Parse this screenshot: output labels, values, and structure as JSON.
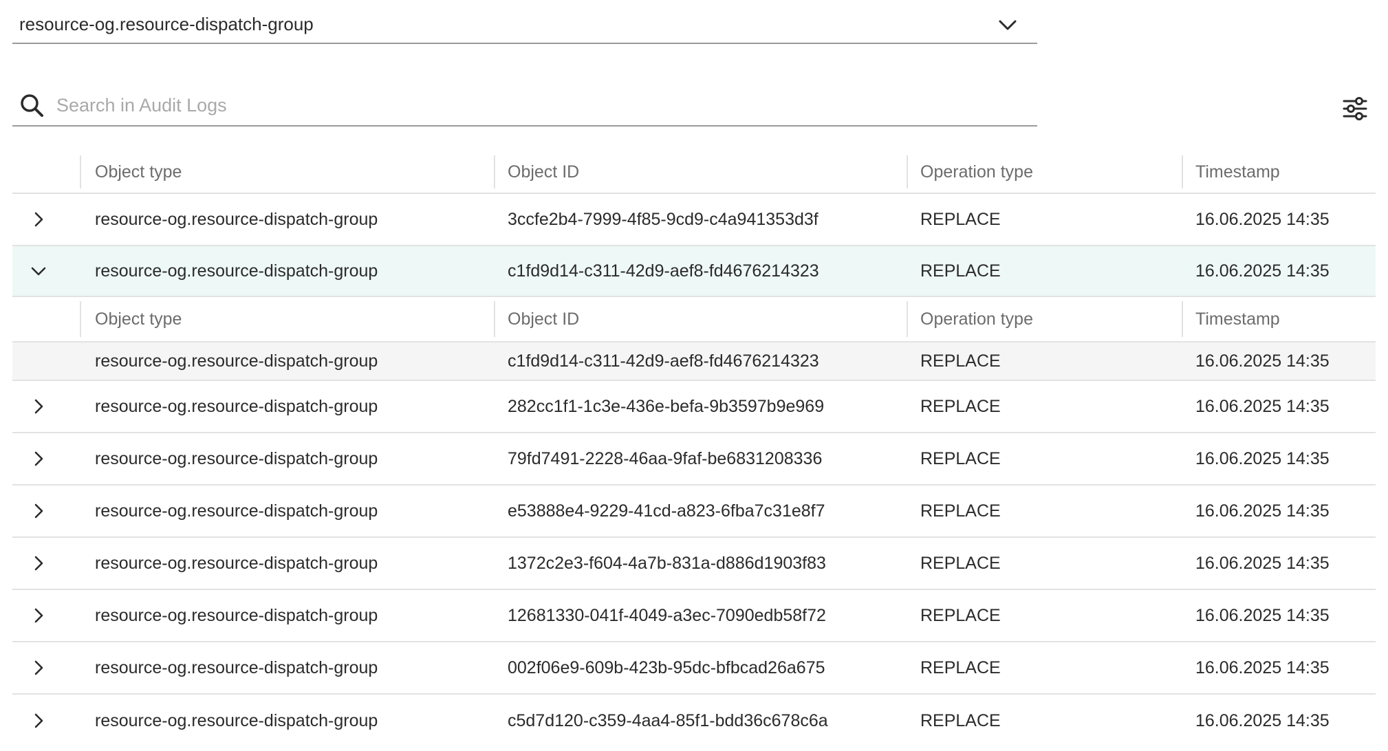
{
  "resource_select": {
    "value": "resource-og.resource-dispatch-group",
    "icon": "chevron-down-icon"
  },
  "search": {
    "placeholder": "Search in Audit Logs",
    "value": "",
    "icon": "search-icon"
  },
  "filter": {
    "icon": "sliders-icon"
  },
  "columns": {
    "object_type": "Object type",
    "object_id": "Object ID",
    "operation_type": "Operation type",
    "timestamp": "Timestamp"
  },
  "rows": [
    {
      "object_type": "resource-og.resource-dispatch-group",
      "object_id": "3ccfe2b4-7999-4f85-9cd9-c4a941353d3f",
      "operation_type": "REPLACE",
      "timestamp": "16.06.2025 14:35",
      "expanded": false
    },
    {
      "object_type": "resource-og.resource-dispatch-group",
      "object_id": "c1fd9d14-c311-42d9-aef8-fd4676214323",
      "operation_type": "REPLACE",
      "timestamp": "16.06.2025 14:35",
      "expanded": true,
      "details": {
        "object_type": "resource-og.resource-dispatch-group",
        "object_id": "c1fd9d14-c311-42d9-aef8-fd4676214323",
        "operation_type": "REPLACE",
        "timestamp": "16.06.2025 14:35"
      }
    },
    {
      "object_type": "resource-og.resource-dispatch-group",
      "object_id": "282cc1f1-1c3e-436e-befa-9b3597b9e969",
      "operation_type": "REPLACE",
      "timestamp": "16.06.2025 14:35",
      "expanded": false
    },
    {
      "object_type": "resource-og.resource-dispatch-group",
      "object_id": "79fd7491-2228-46aa-9faf-be6831208336",
      "operation_type": "REPLACE",
      "timestamp": "16.06.2025 14:35",
      "expanded": false
    },
    {
      "object_type": "resource-og.resource-dispatch-group",
      "object_id": "e53888e4-9229-41cd-a823-6fba7c31e8f7",
      "operation_type": "REPLACE",
      "timestamp": "16.06.2025 14:35",
      "expanded": false
    },
    {
      "object_type": "resource-og.resource-dispatch-group",
      "object_id": "1372c2e3-f604-4a7b-831a-d886d1903f83",
      "operation_type": "REPLACE",
      "timestamp": "16.06.2025 14:35",
      "expanded": false
    },
    {
      "object_type": "resource-og.resource-dispatch-group",
      "object_id": "12681330-041f-4049-a3ec-7090edb58f72",
      "operation_type": "REPLACE",
      "timestamp": "16.06.2025 14:35",
      "expanded": false
    },
    {
      "object_type": "resource-og.resource-dispatch-group",
      "object_id": "002f06e9-609b-423b-95dc-bfbcad26a675",
      "operation_type": "REPLACE",
      "timestamp": "16.06.2025 14:35",
      "expanded": false
    },
    {
      "object_type": "resource-og.resource-dispatch-group",
      "object_id": "c5d7d120-c359-4aa4-85f1-bdd36c678c6a",
      "operation_type": "REPLACE",
      "timestamp": "16.06.2025 14:35",
      "expanded": false
    }
  ],
  "colors": {
    "expanded_row_bg": "#eef8f6",
    "detail_row_bg": "#f5f5f5",
    "header_text": "#6c6c6c",
    "divider": "#e2e2e2"
  }
}
